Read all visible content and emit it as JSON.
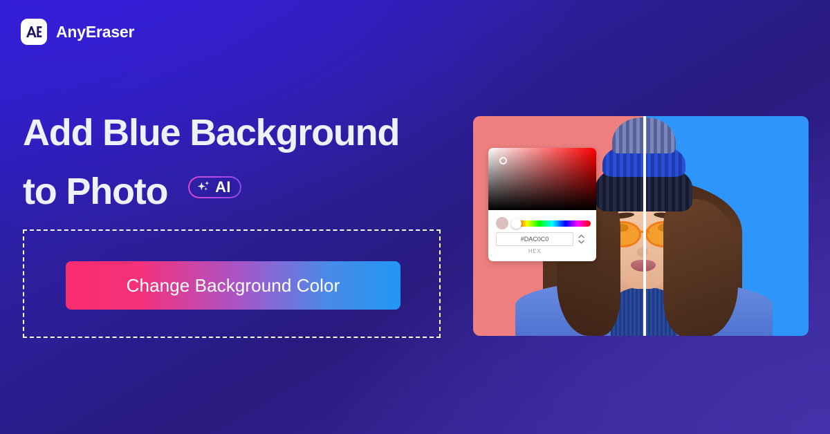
{
  "brand": {
    "name": "AnyEraser",
    "mark_icon": "ae-monogram-icon",
    "mark_text": "AE"
  },
  "hero": {
    "headline_line1": "Add Blue Background",
    "headline_line2": "to Photo",
    "ai_badge": {
      "label": "AI",
      "icon": "sparkle-icon",
      "border_gradient_from": "#E846C8",
      "border_gradient_to": "#8A4BF0"
    },
    "cta": {
      "label": "Change Background Color",
      "gradient_from": "#FA2D6E",
      "gradient_to": "#2196F3"
    }
  },
  "preview": {
    "before_background_color": "#F08080",
    "after_background_color": "#2E96FB",
    "divider_color": "#FFFFFF",
    "subject_description": "woman in blue knit beanie and orange sunglasses"
  },
  "color_picker": {
    "hex_value": "#DAC0C0",
    "hex_label": "HEX",
    "swatch_color": "#DAC0C0",
    "sv_handle_icon": "color-handle-icon",
    "hue_handle_icon": "hue-handle-icon",
    "stepper_up_icon": "chevron-up-icon",
    "stepper_down_icon": "chevron-down-icon"
  },
  "page": {
    "background_gradient_from": "#2A1BC7",
    "background_gradient_to": "#3E2CA0"
  }
}
